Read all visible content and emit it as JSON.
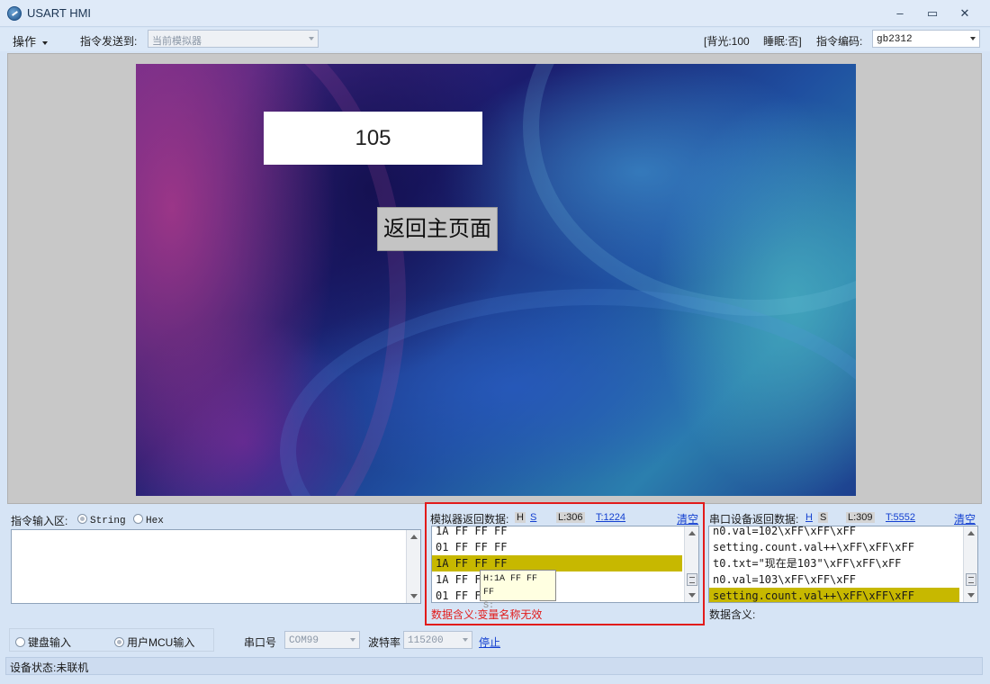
{
  "window": {
    "title": "USART HMI",
    "controls": {
      "minimize": "–",
      "maximize": "▭",
      "close": "✕"
    }
  },
  "toolbar": {
    "operate_label": "操作",
    "send_to_label": "指令发送到:",
    "send_to_value": "当前模拟器",
    "backlight": "[背光:100",
    "sleep": "睡眠:否]",
    "encoding_label": "指令编码:",
    "encoding_value": "gb2312"
  },
  "simulator": {
    "number_value": "105",
    "home_button_label": "返回主页面"
  },
  "command_input": {
    "label": "指令输入区:",
    "mode_string": "String",
    "mode_hex": "Hex",
    "selected_mode": "String"
  },
  "sim_return": {
    "label": "模拟器返回数据:",
    "h_label": "H",
    "s_label": "S",
    "l_count": "L:306",
    "t_count": "T:1224",
    "clear_label": "清空",
    "lines": [
      "1A FF FF FF",
      "01 FF FF FF",
      "1A FF FF FF",
      "1A FF FF FF",
      "01 FF FF FF"
    ],
    "highlight_index": 2,
    "meaning": "数据含义:变量名称无效",
    "tooltip_h": "H:1A FF FF FF",
    "tooltip_s": "S:"
  },
  "serial_return": {
    "label": "串口设备返回数据:",
    "h_label": "H",
    "s_label": "S",
    "l_count": "L:309",
    "t_count": "T:5552",
    "clear_label": "清空",
    "lines": [
      "n0.val=102\\xFF\\xFF\\xFF",
      "setting.count.val++\\xFF\\xFF\\xFF",
      "t0.txt=\"现在是103\"\\xFF\\xFF\\xFF",
      "n0.val=103\\xFF\\xFF\\xFF",
      "setting.count.val++\\xFF\\xFF\\xFF"
    ],
    "highlight_index": 4,
    "meaning": "数据含义:"
  },
  "input_source": {
    "keyboard": "键盘输入",
    "mcu": "用户MCU输入",
    "selected": "用户MCU输入"
  },
  "serial_port": {
    "port_label": "串口号",
    "port_value": "COM99",
    "baud_label": "波特率",
    "baud_value": "115200",
    "stop_label": "停止"
  },
  "status": {
    "text": "设备状态:未联机"
  },
  "colors": {
    "highlight": "#c7b800",
    "error_text": "#e21b1b",
    "link": "#1440d0",
    "frame_red": "#e21b1b"
  }
}
